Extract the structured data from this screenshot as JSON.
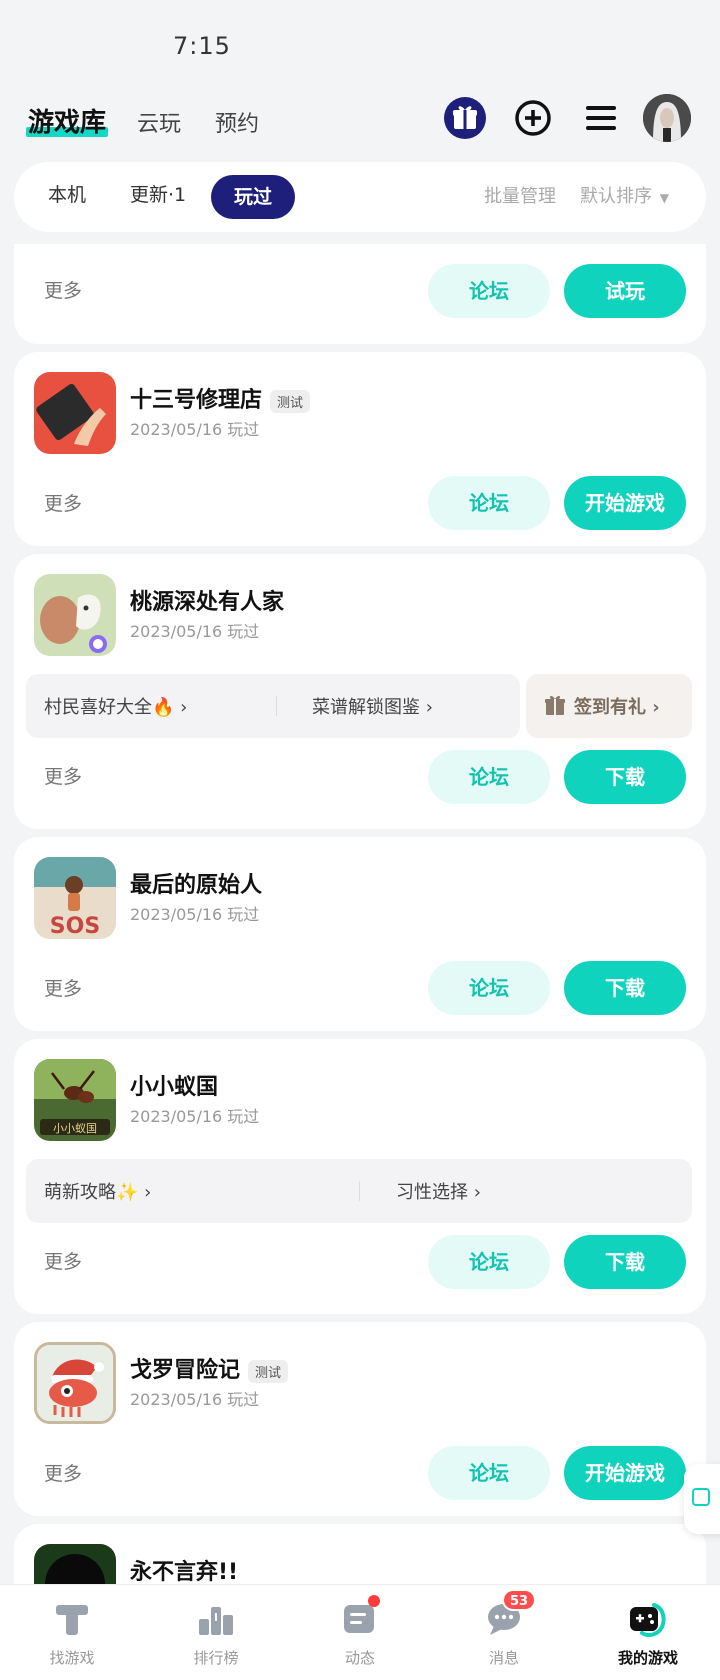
{
  "status_bar": {
    "time": "7:15"
  },
  "header": {
    "tabs": [
      {
        "label": "游戏库",
        "active": true
      },
      {
        "label": "云玩",
        "active": false
      },
      {
        "label": "预约",
        "active": false
      }
    ],
    "icons": [
      "gift-box-icon",
      "plus-circle-icon",
      "menu-icon",
      "avatar"
    ]
  },
  "filter": {
    "chips": [
      "本机",
      "更新·1",
      "玩过"
    ],
    "active_chip": "玩过",
    "batch_manage": "批量管理",
    "sort_label": "默认排序"
  },
  "games": [
    {
      "more": "更多",
      "forum": "论坛",
      "action": "试玩"
    },
    {
      "title": "十三号修理店",
      "badge": "测试",
      "date": "2023/05/16 玩过",
      "more": "更多",
      "forum": "论坛",
      "action": "开始游戏"
    },
    {
      "title": "桃源深处有人家",
      "date": "2023/05/16 玩过",
      "tips": [
        "村民喜好大全🔥",
        "菜谱解锁图鉴"
      ],
      "gift": "签到有礼",
      "more": "更多",
      "forum": "论坛",
      "action": "下载"
    },
    {
      "title": "最后的原始人",
      "date": "2023/05/16 玩过",
      "more": "更多",
      "forum": "论坛",
      "action": "下载"
    },
    {
      "title": "小小蚁国",
      "date": "2023/05/16 玩过",
      "tips": [
        "萌新攻略✨",
        "习性选择"
      ],
      "more": "更多",
      "forum": "论坛",
      "action": "下载"
    },
    {
      "title": "戈罗冒险记",
      "badge": "测试",
      "date": "2023/05/16 玩过",
      "more": "更多",
      "forum": "论坛",
      "action": "开始游戏"
    },
    {
      "title": "永不言弃!!"
    }
  ],
  "bottom_nav": [
    {
      "label": "找游戏",
      "icon": "find-game-icon"
    },
    {
      "label": "排行榜",
      "icon": "ranking-icon"
    },
    {
      "label": "动态",
      "icon": "feed-icon",
      "dot": true
    },
    {
      "label": "消息",
      "icon": "message-icon",
      "badge": "53"
    },
    {
      "label": "我的游戏",
      "icon": "my-games-icon",
      "active": true
    }
  ],
  "colors": {
    "accent": "#10d3bd",
    "accent_light": "#e3faf7",
    "chip_active": "#1e1f7a",
    "badge_red": "#ff4d4d"
  }
}
